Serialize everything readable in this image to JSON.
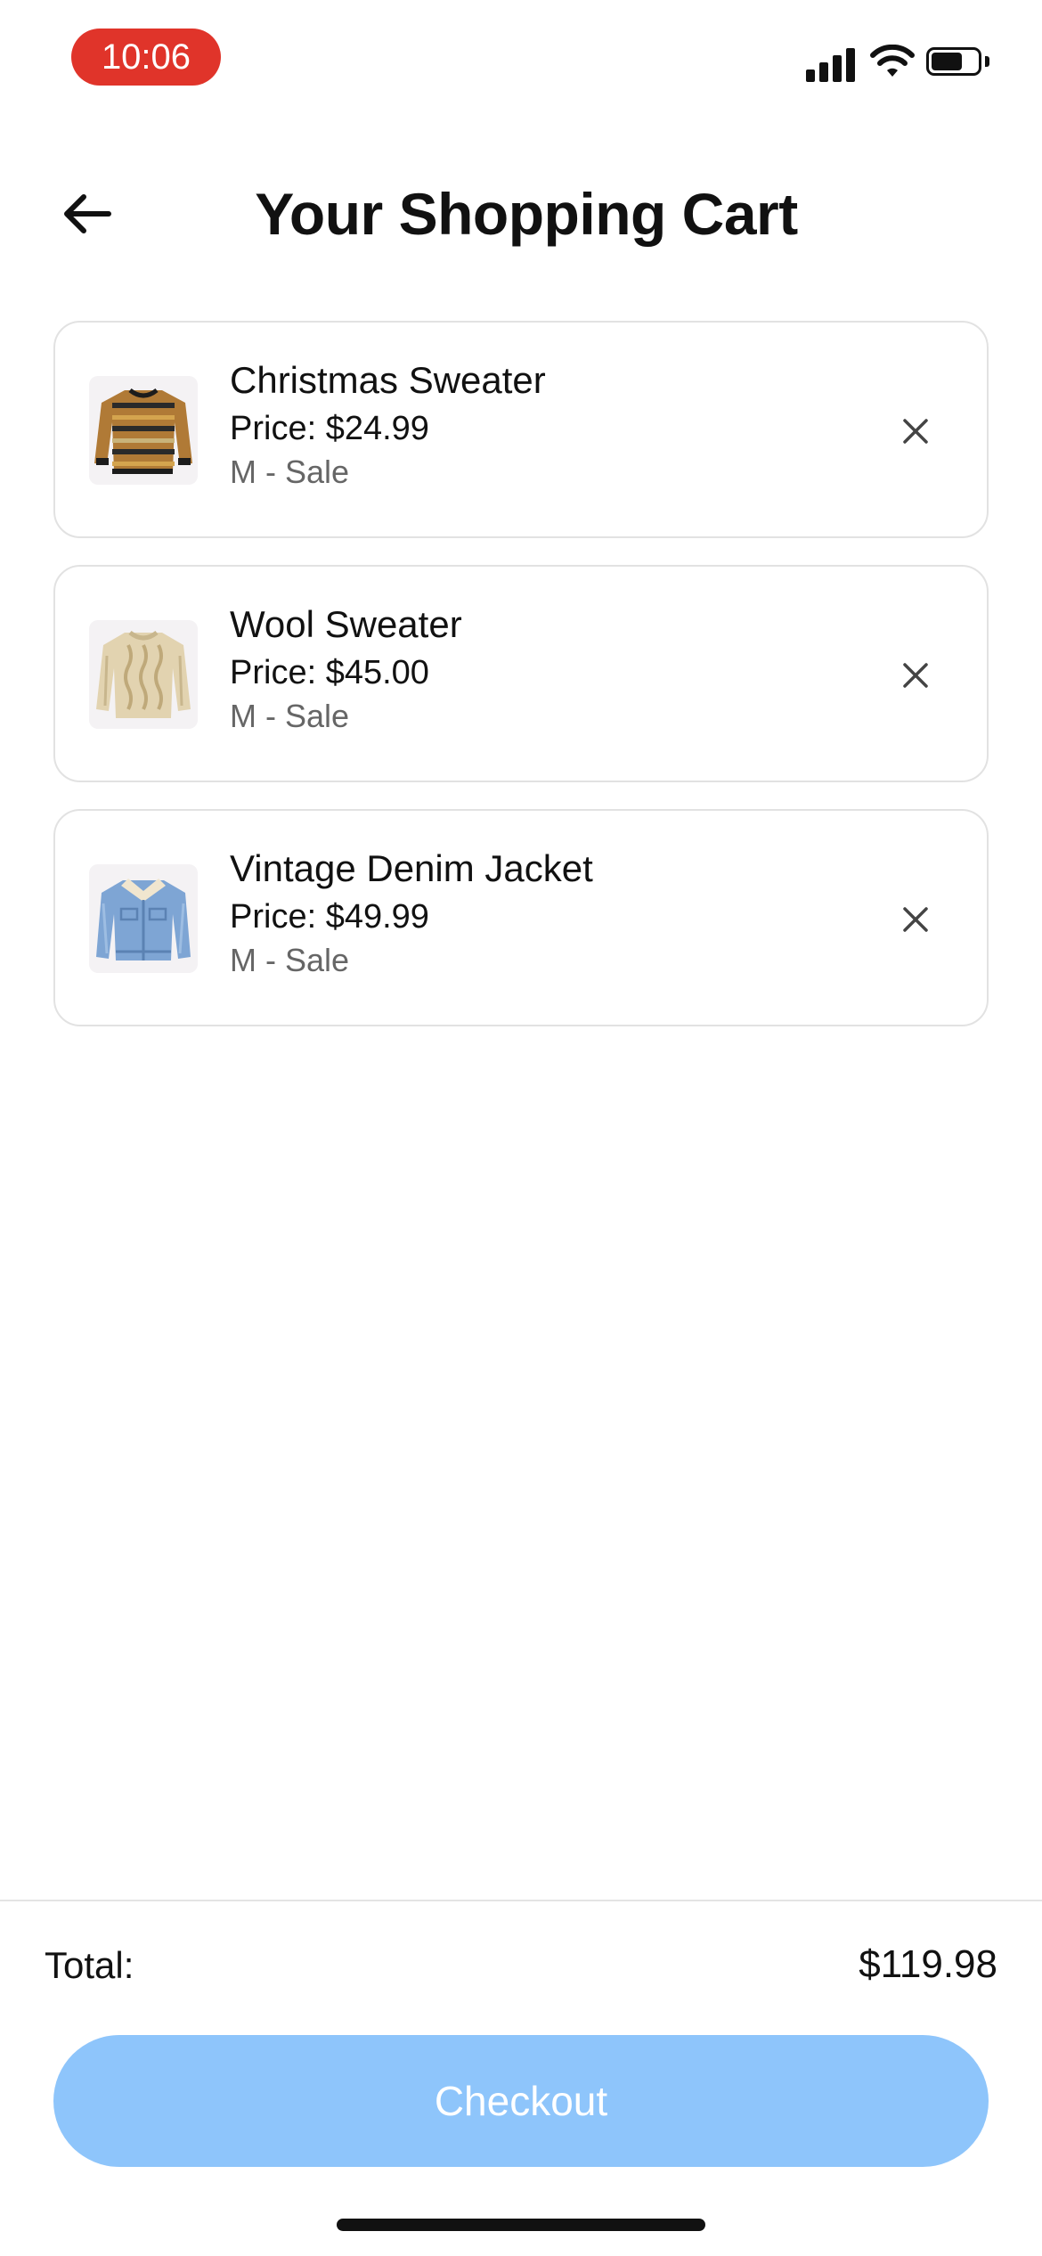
{
  "status_bar": {
    "time": "10:06",
    "time_pill_color": "#e0342a"
  },
  "header": {
    "title": "Your Shopping Cart",
    "back_icon": "arrow-left-icon"
  },
  "cart": {
    "items": [
      {
        "name": "Christmas Sweater",
        "price": "Price: $24.99",
        "variant": "M - Sale",
        "thumb_icon": "striped-sweater-image"
      },
      {
        "name": "Wool Sweater",
        "price": "Price: $45.00",
        "variant": "M - Sale",
        "thumb_icon": "cable-knit-sweater-image"
      },
      {
        "name": "Vintage Denim Jacket",
        "price": "Price: $49.99",
        "variant": "M - Sale",
        "thumb_icon": "denim-jacket-image"
      }
    ],
    "remove_icon": "close-icon"
  },
  "footer": {
    "total_label": "Total:",
    "total_value": "$119.98",
    "checkout_label": "Checkout",
    "checkout_color": "#8ec5fb"
  }
}
